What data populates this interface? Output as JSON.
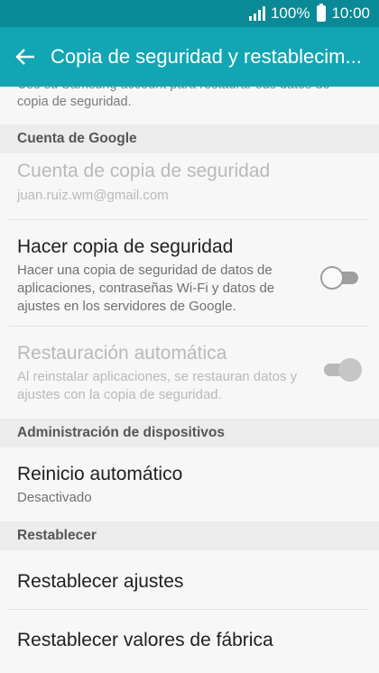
{
  "status": {
    "battery_text": "100%",
    "time": "10:00"
  },
  "appbar": {
    "title": "Copia de seguridad y restablecim..."
  },
  "top_text": "Use su Samsung account para restaurar sus datos de copia de seguridad.",
  "sections": {
    "google": "Cuenta de Google",
    "devices": "Administración de dispositivos",
    "reset": "Restablecer"
  },
  "items": {
    "backup_account": {
      "title": "Cuenta de copia de seguridad",
      "sub": "juan.ruiz.wm@gmail.com"
    },
    "backup": {
      "title": "Hacer copia de seguridad",
      "sub": "Hacer una copia de seguridad de datos de aplicaciones, contraseñas Wi-Fi y datos de ajustes en los servidores de Google.",
      "toggle": "off"
    },
    "auto_restore": {
      "title": "Restauración automática",
      "sub": "Al reinstalar aplicaciones, se restauran datos y ajustes con la copia de seguridad.",
      "toggle": "on (disabled)"
    },
    "auto_restart": {
      "title": "Reinicio automático",
      "sub": "Desactivado"
    },
    "reset_settings": {
      "title": "Restablecer ajustes"
    },
    "factory_reset": {
      "title": "Restablecer valores de fábrica"
    }
  },
  "colors": {
    "app_bar": "#12a6b4",
    "status_bar": "#0a8a96"
  }
}
